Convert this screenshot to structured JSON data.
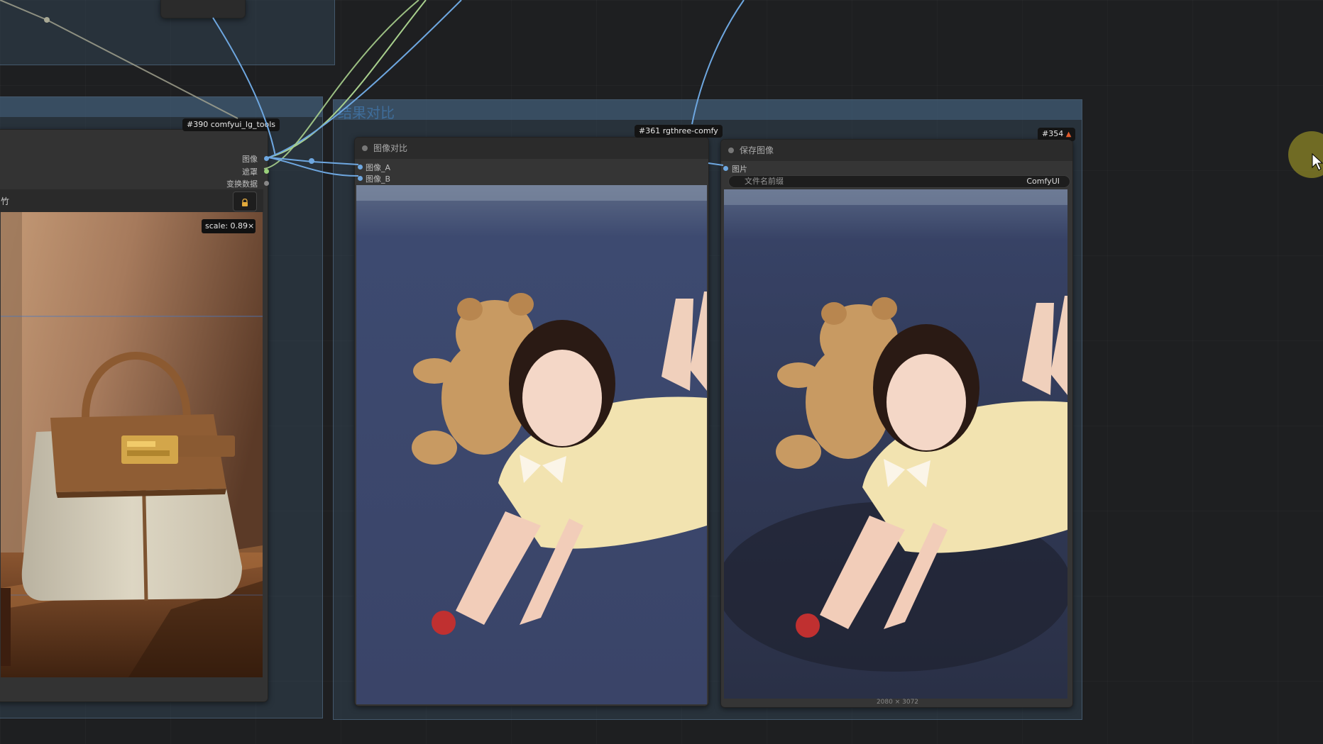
{
  "groups": {
    "top_left": {
      "title": ""
    },
    "left": {
      "title": ""
    },
    "compare": {
      "title": "结果对比"
    }
  },
  "nodes": {
    "lg_tools": {
      "badge": "#390 comfyui_lg_tools",
      "outputs": [
        "图像",
        "遮罩",
        "变换数据"
      ],
      "scale_label": "scale: 0.89×",
      "lock_icon": "lock-icon",
      "edge_text": "竹"
    },
    "image_compare": {
      "badge": "#361 rgthree-comfy",
      "title": "图像对比",
      "inputs": [
        "图像_A",
        "图像_B"
      ]
    },
    "save_image": {
      "badge": "#354",
      "badge_icon": "fox-icon",
      "title": "保存图像",
      "input": "图片",
      "filename_label": "文件名前缀",
      "filename_value": "ComfyUI",
      "size_label": "2080 × 3072"
    }
  },
  "colors": {
    "link_blue": "#6ea7e0",
    "link_green": "#a8d08d",
    "link_gray": "#9a9a8a",
    "cursor_ring": "#b4aa28"
  },
  "cursor": {
    "icon": "pointer-cursor-icon"
  }
}
